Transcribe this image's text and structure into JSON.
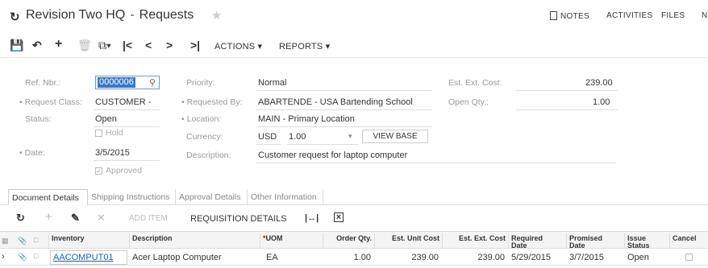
{
  "header": {
    "app_title": "Revision Two HQ",
    "separator": "-",
    "page_title": "Requests",
    "star_icon": "star-icon",
    "links": {
      "notes": "NOTES",
      "activities": "ACTIVITIES",
      "files": "FILES",
      "more": "N"
    }
  },
  "toolbar": {
    "actions_label": "ACTIONS",
    "reports_label": "REPORTS",
    "icons": [
      "save-icon",
      "undo-icon",
      "add-icon",
      "delete-icon",
      "copy-paste-icon",
      "first-icon",
      "prev-icon",
      "next-icon",
      "last-icon"
    ]
  },
  "form": {
    "ref_nbr": {
      "label": "Ref. Nbr.:",
      "value": "0000006"
    },
    "request_class": {
      "label": "Request Class:",
      "value": "CUSTOMER -"
    },
    "status": {
      "label": "Status:",
      "value": "Open"
    },
    "hold": {
      "label": "Hold",
      "checked": false
    },
    "date": {
      "label": "Date:",
      "value": "3/5/2015"
    },
    "approved": {
      "label": "Approved",
      "checked": true
    },
    "priority": {
      "label": "Priority:",
      "value": "Normal"
    },
    "requested_by": {
      "label": "Requested By:",
      "value": "ABARTENDE - USA Bartending School"
    },
    "location": {
      "label": "Location:",
      "value": "MAIN - Primary Location"
    },
    "currency": {
      "label": "Currency:",
      "value": "USD",
      "rate": "1.00",
      "view_base_label": "VIEW BASE"
    },
    "description": {
      "label": "Description:",
      "value": "Customer request for laptop computer"
    },
    "est_ext_cost": {
      "label": "Est. Ext. Cost:",
      "value": "239.00"
    },
    "open_qty": {
      "label": "Open Qty.:",
      "value": "1.00"
    },
    "required_marker": "•"
  },
  "tabs": [
    {
      "label": "Document Details",
      "active": true
    },
    {
      "label": "Shipping Instructions",
      "active": false
    },
    {
      "label": "Approval Details",
      "active": false
    },
    {
      "label": "Other Information",
      "active": false
    }
  ],
  "grid_toolbar": {
    "add_item_label": "ADD ITEM",
    "requisition_details_label": "REQUISITION DETAILS"
  },
  "grid": {
    "columns": {
      "inventory": "Inventory",
      "description": "Description",
      "uom_marker": "*",
      "uom": "UOM",
      "order_qty": "Order Qty.",
      "est_unit_cost": "Est. Unit Cost",
      "est_ext_cost": "Est. Ext. Cost",
      "required_date_1": "Required",
      "required_date_2": "Date",
      "promised_date_1": "Promised",
      "promised_date_2": "Date",
      "issue_status_1": "Issue",
      "issue_status_2": "Status",
      "cancel": "Cancel"
    },
    "rows": [
      {
        "inventory": "AACOMPUT01",
        "description": "Acer Laptop Computer",
        "uom": "EA",
        "order_qty": "1.00",
        "est_unit_cost": "239.00",
        "est_ext_cost": "239.00",
        "required_date": "5/29/2015",
        "promised_date": "3/7/2015",
        "issue_status": "Open",
        "cancel": false
      }
    ]
  }
}
